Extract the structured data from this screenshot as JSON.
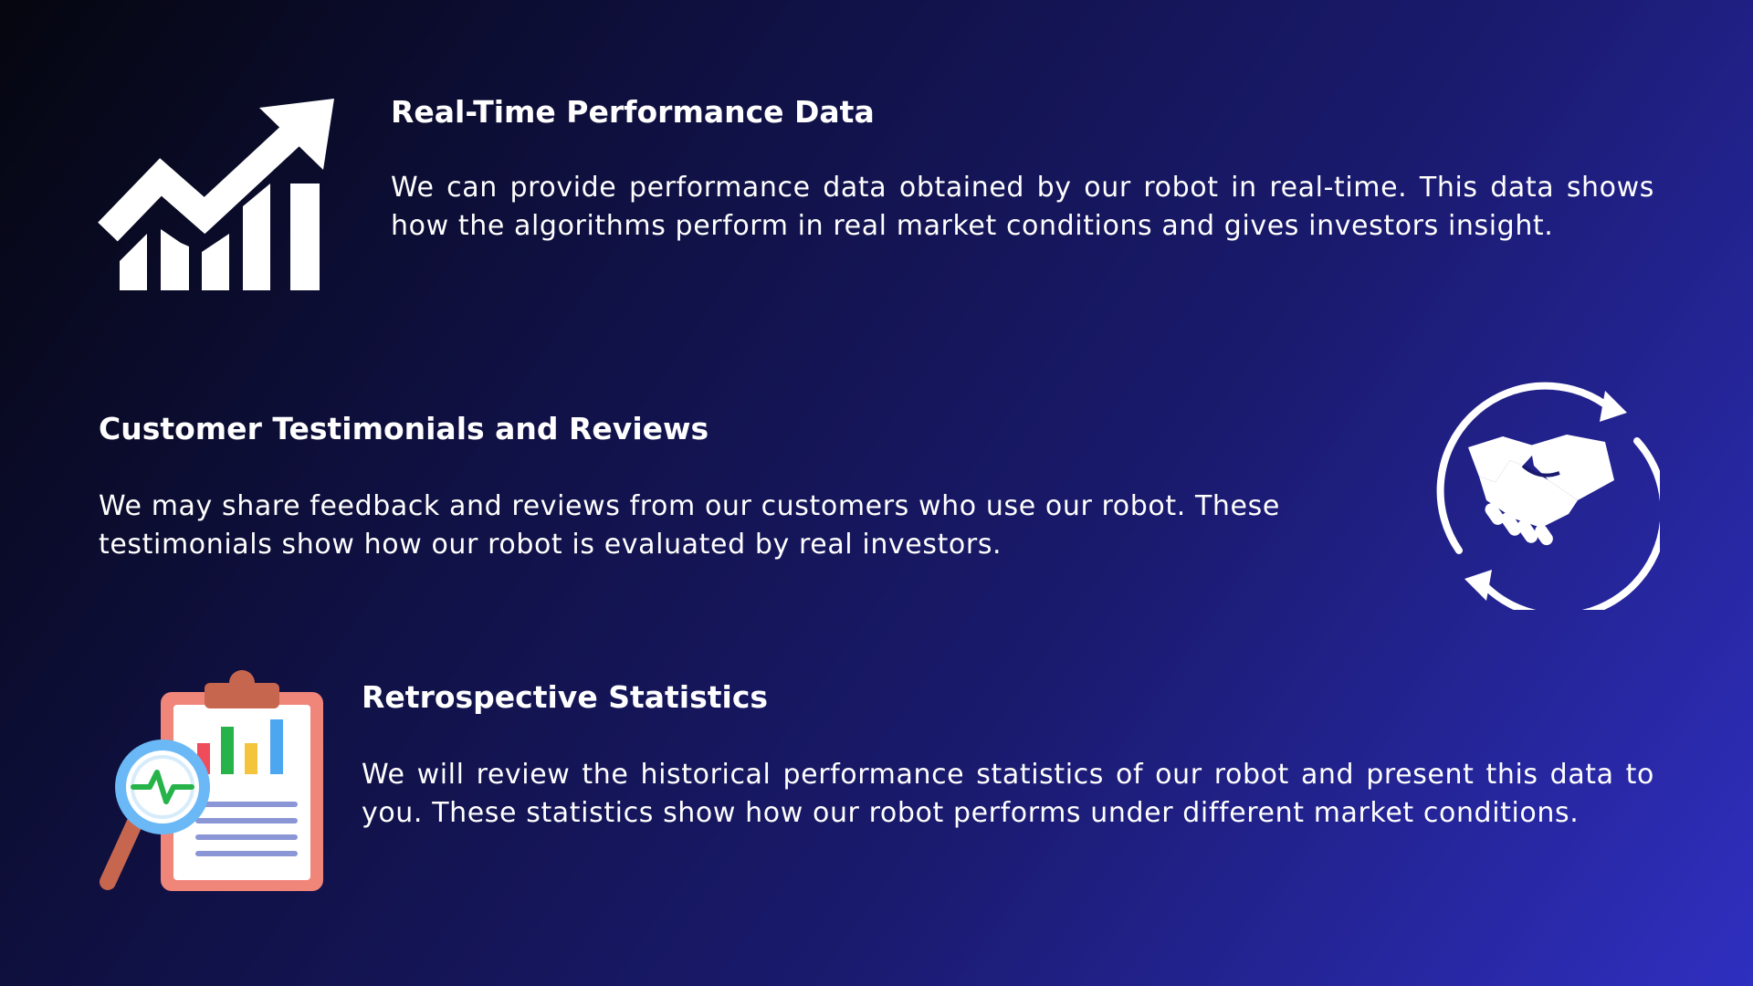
{
  "sections": [
    {
      "title": "Real-Time Performance Data",
      "body": "We can provide performance data obtained by our robot in real-time. This data shows how the algorithms perform in real market conditions and gives investors insight.",
      "icon": "growth-chart-icon"
    },
    {
      "title": "Customer Testimonials and Reviews",
      "body": "We may share feedback and reviews from our customers who use our robot. These testimonials show how our robot is evaluated by real investors.",
      "icon": "handshake-icon"
    },
    {
      "title": "Retrospective Statistics",
      "body": "We will review the historical performance statistics of our robot and present this data to you. These statistics show how our robot performs under different market conditions.",
      "icon": "clipboard-analytics-icon"
    }
  ],
  "colors": {
    "background_start": "#05060f",
    "background_end": "#2f2fc0",
    "text": "#ffffff",
    "clipboard_frame": "#f0857a",
    "clipboard_clip": "#c7664f",
    "magnifier_ring": "#6ab8f5",
    "pulse_line": "#26b34a"
  }
}
